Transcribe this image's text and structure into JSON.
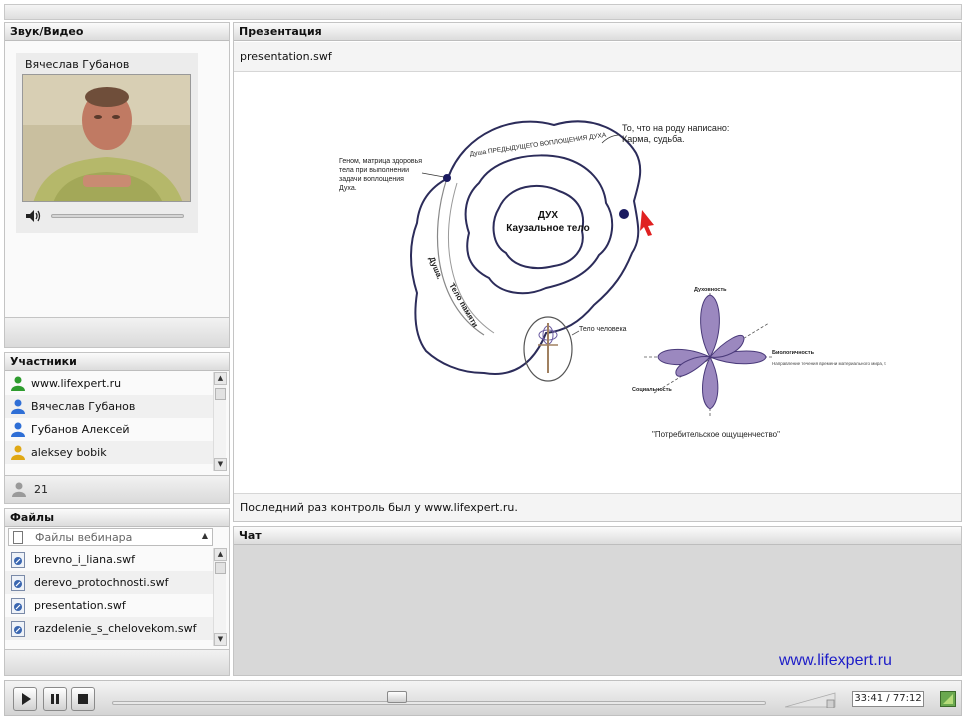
{
  "av": {
    "title": "Звук/Видео",
    "speaker": "Вячеслав Губанов",
    "volume": 0.0
  },
  "participants": {
    "title": "Участники",
    "items": [
      {
        "name": "www.lifexpert.ru",
        "color": "#2e9c2e"
      },
      {
        "name": "Вячеслав Губанов",
        "color": "#2f6fd6"
      },
      {
        "name": "Губанов Алексей",
        "color": "#2f6fd6"
      },
      {
        "name": "aleksey bobik",
        "color": "#e0a814"
      }
    ],
    "count": "21"
  },
  "files": {
    "title": "Файлы",
    "folder": "Файлы вебинара",
    "items": [
      "brevno_i_liana.swf",
      "derevo_protochnosti.swf",
      "presentation.swf",
      "razdelenie_s_chelovekom.swf"
    ]
  },
  "presentation": {
    "title": "Презентация",
    "file": "presentation.swf",
    "status": "Последний раз контроль был у www.lifexpert.ru.",
    "slide": {
      "top_note": [
        "То, что на роду написано:",
        "Карма, судьба."
      ],
      "left_note": [
        "Геном, матрица здоровья",
        "тела при выполнении",
        "задачи воплощения",
        "Духа."
      ],
      "core_title": "ДУХ",
      "core_sub": "Каузальное тело",
      "arc_label": "Душа ПРЕДЫДУЩЕГО ВОПЛОЩЕНИЯ ДУХА",
      "soul": "Душа.",
      "memory": "Тело памяти",
      "human": "Тело человека",
      "axis_top": "Духовность",
      "axis_right": "Биологичность",
      "axis_right_note": "Направление течения времени материального мира, t",
      "axis_left": "Социальность",
      "caption": "\"Потребительское ощущенчество\""
    }
  },
  "chat": {
    "title": "Чат",
    "brand": "www.lifexpert.ru"
  },
  "player": {
    "time": "33:41 / 77:12",
    "progress": 0.436
  }
}
